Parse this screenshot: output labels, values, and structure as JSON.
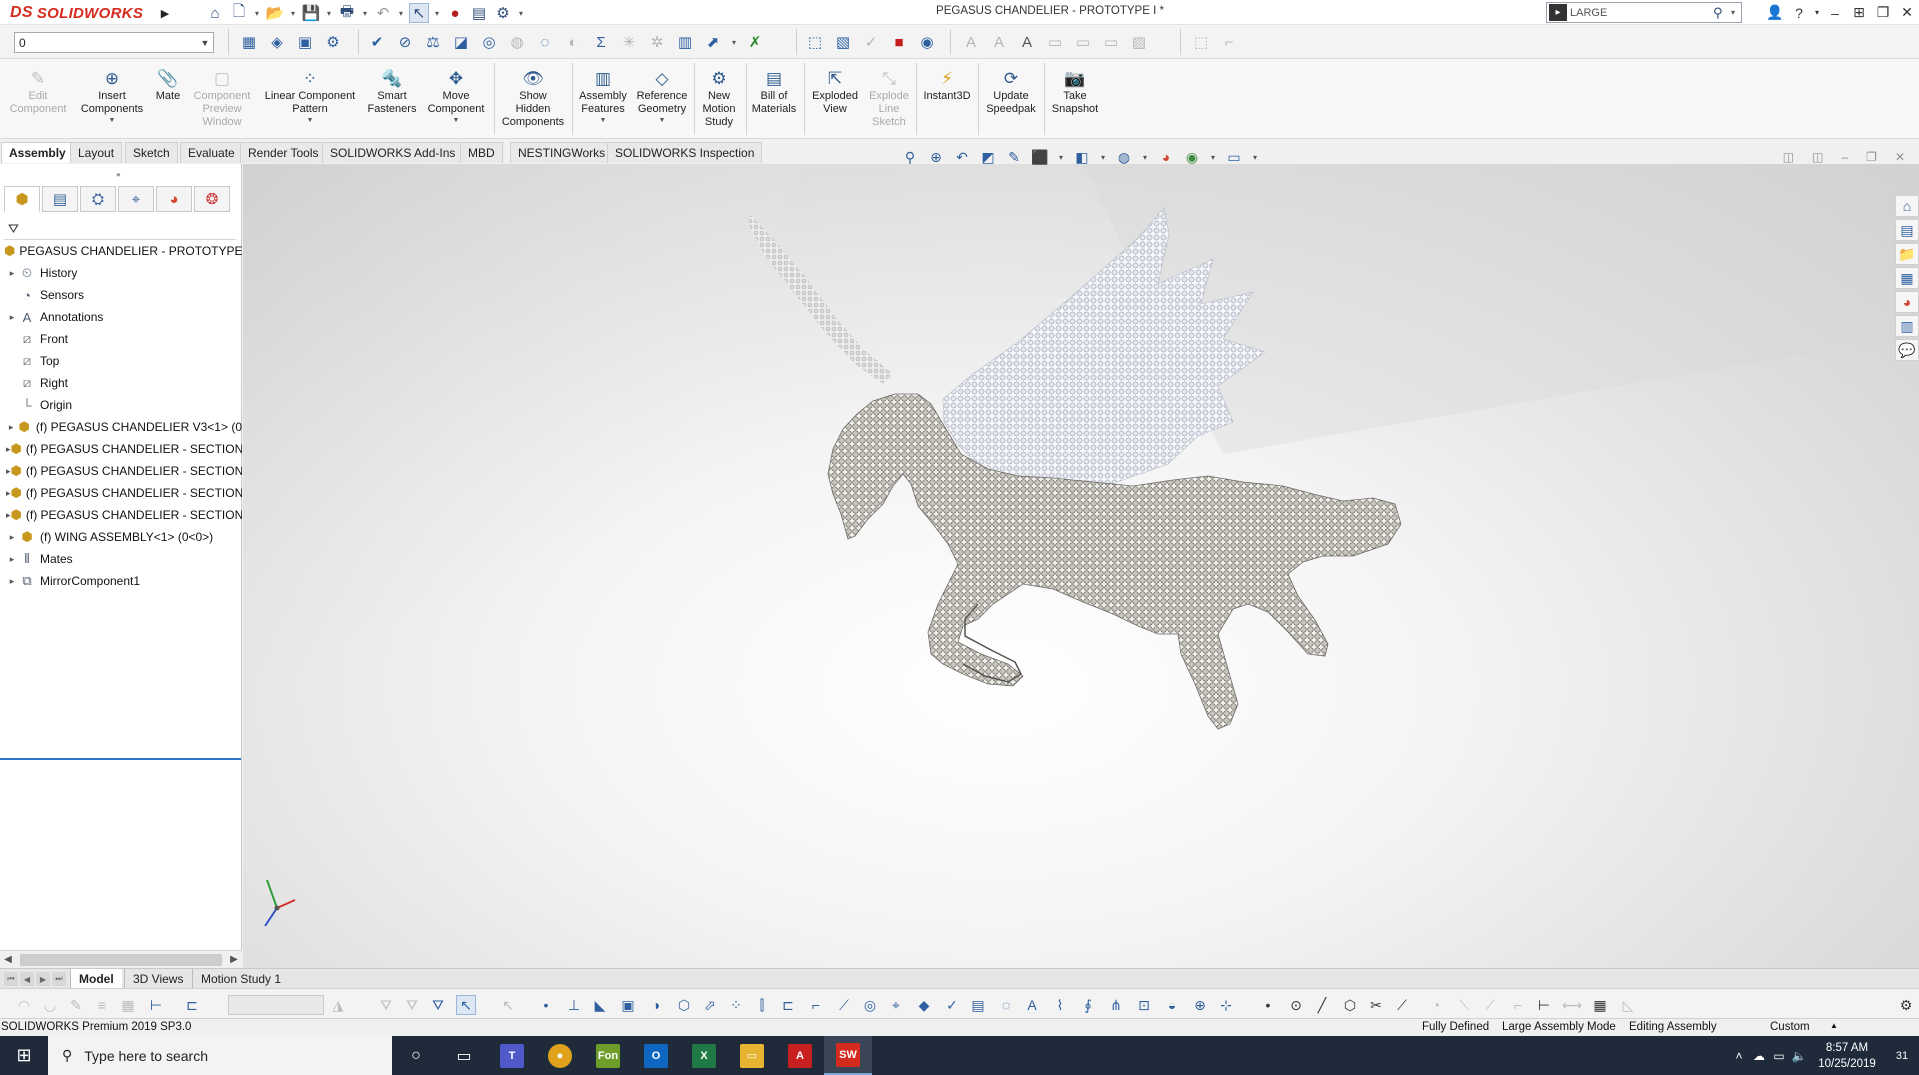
{
  "titlebar": {
    "logo_prefix": "DS",
    "logo_text": "SOLIDWORKS",
    "document_title": "PEGASUS CHANDELIER - PROTOTYPE I *",
    "search_value": "LARGE"
  },
  "toolbar2": {
    "configuration_value": "0"
  },
  "ribbon": {
    "buttons": [
      {
        "label": "Edit\nComponent"
      },
      {
        "label": "Insert\nComponents"
      },
      {
        "label": "Mate"
      },
      {
        "label": "Component\nPreview\nWindow"
      },
      {
        "label": "Linear Component\nPattern"
      },
      {
        "label": "Smart\nFasteners"
      },
      {
        "label": "Move\nComponent"
      },
      {
        "label": "Show\nHidden\nComponents"
      },
      {
        "label": "Assembly\nFeatures"
      },
      {
        "label": "Reference\nGeometry"
      },
      {
        "label": "New\nMotion\nStudy"
      },
      {
        "label": "Bill of\nMaterials"
      },
      {
        "label": "Exploded\nView"
      },
      {
        "label": "Explode\nLine\nSketch"
      },
      {
        "label": "Instant3D"
      },
      {
        "label": "Update\nSpeedpak"
      },
      {
        "label": "Take\nSnapshot"
      }
    ]
  },
  "tabs": [
    {
      "label": "Assembly"
    },
    {
      "label": "Layout"
    },
    {
      "label": "Sketch"
    },
    {
      "label": "Evaluate"
    },
    {
      "label": "Render Tools"
    },
    {
      "label": "SOLIDWORKS Add-Ins"
    },
    {
      "label": "MBD"
    },
    {
      "label": "NESTINGWorks"
    },
    {
      "label": "SOLIDWORKS Inspection"
    }
  ],
  "feature_tree": {
    "root": "PEGASUS CHANDELIER - PROTOTYPE I  (",
    "items": [
      {
        "label": "History"
      },
      {
        "label": "Sensors"
      },
      {
        "label": "Annotations"
      },
      {
        "label": "Front"
      },
      {
        "label": "Top"
      },
      {
        "label": "Right"
      },
      {
        "label": "Origin"
      },
      {
        "label": "(f) PEGASUS CHANDELIER V3<1> (0"
      },
      {
        "label": "(f) PEGASUS CHANDELIER - SECTION"
      },
      {
        "label": "(f) PEGASUS CHANDELIER - SECTION"
      },
      {
        "label": "(f) PEGASUS CHANDELIER - SECTION"
      },
      {
        "label": "(f) PEGASUS CHANDELIER - SECTION"
      },
      {
        "label": "(f) WING ASSEMBLY<1> (0<0>)"
      },
      {
        "label": "Mates"
      },
      {
        "label": "MirrorComponent1"
      }
    ]
  },
  "model_tabs": [
    {
      "label": "Model"
    },
    {
      "label": "3D Views"
    },
    {
      "label": "Motion Study 1"
    }
  ],
  "status": {
    "product": "SOLIDWORKS Premium 2019 SP3.0",
    "defined": "Fully Defined",
    "mode": "Large Assembly Mode",
    "editing": "Editing Assembly",
    "units": "Custom"
  },
  "taskbar": {
    "search_placeholder": "Type here to search",
    "time": "8:57 AM",
    "date": "10/25/2019",
    "notification_count": "31",
    "apps": [
      {
        "label": "Fon"
      },
      {
        "label": "X"
      },
      {
        "label": "A"
      },
      {
        "label": "SW"
      }
    ]
  },
  "colors": {
    "brand": "#d52b1e",
    "accent": "#2a76c7",
    "taskbar": "#1f2b3a"
  }
}
